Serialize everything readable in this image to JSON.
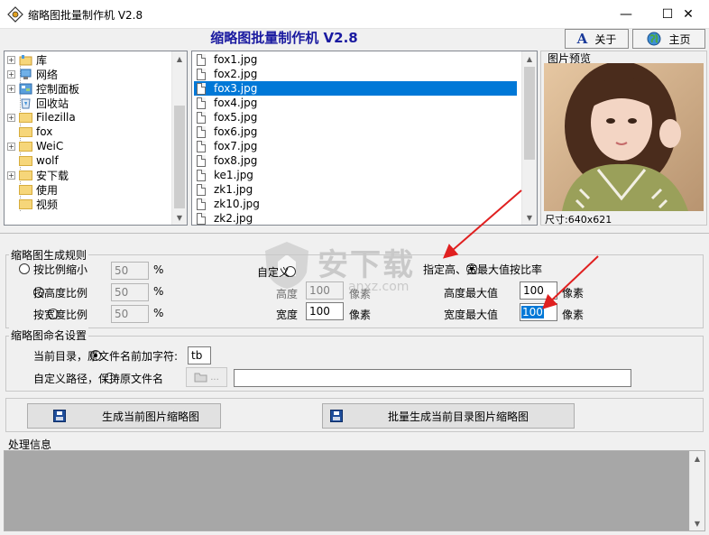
{
  "window": {
    "title": "缩略图批量制作机 V2.8",
    "minimize_glyph": "—",
    "maximize_glyph": "☐",
    "close_glyph": "✕"
  },
  "header": {
    "heading": "缩略图批量制作机  V2.8",
    "about_label": "关于",
    "home_label": "主页"
  },
  "tree": {
    "items": [
      {
        "label": "库",
        "expander": "+",
        "icon": "library-icon"
      },
      {
        "label": "网络",
        "expander": "+",
        "icon": "network-icon"
      },
      {
        "label": "控制面板",
        "expander": "+",
        "icon": "control-panel-icon"
      },
      {
        "label": "回收站",
        "expander": "",
        "icon": "recycle-bin-icon"
      },
      {
        "label": "Filezilla",
        "expander": "+",
        "icon": "folder-icon"
      },
      {
        "label": "fox",
        "expander": "",
        "icon": "folder-icon"
      },
      {
        "label": "WeiC",
        "expander": "+",
        "icon": "folder-icon"
      },
      {
        "label": "wolf",
        "expander": "",
        "icon": "folder-icon"
      },
      {
        "label": "安下载",
        "expander": "+",
        "icon": "folder-icon"
      },
      {
        "label": "使用",
        "expander": "",
        "icon": "folder-icon"
      },
      {
        "label": "视频",
        "expander": "",
        "icon": "folder-icon"
      }
    ]
  },
  "files": {
    "items": [
      "fox1.jpg",
      "fox2.jpg",
      "fox3.jpg",
      "fox4.jpg",
      "fox5.jpg",
      "fox6.jpg",
      "fox7.jpg",
      "fox8.jpg",
      "ke1.jpg",
      "zk1.jpg",
      "zk10.jpg",
      "zk2.jpg"
    ],
    "selected": "fox3.jpg"
  },
  "preview": {
    "title": "图片预览",
    "size_text": "尺寸:640x621"
  },
  "rules": {
    "legend": "缩略图生成规则",
    "scale_label": "按比例缩小",
    "scale_value": "50",
    "scale_unit": "%",
    "by_height_label": "按高度比例",
    "by_height_value": "50",
    "by_height_unit": "%",
    "by_width_label": "按宽度比例",
    "by_width_value": "50",
    "by_width_unit": "%",
    "custom_label": "自定义",
    "custom_height_label": "高度",
    "custom_height_value": "100",
    "custom_height_unit": "像素",
    "custom_width_label": "宽度",
    "custom_width_value": "100",
    "custom_width_unit": "像素",
    "max_label": "指定高、宽最大值按比率",
    "max_height_label": "高度最大值",
    "max_height_value": "100",
    "max_height_unit": "像素",
    "max_width_label": "宽度最大值",
    "max_width_value": "100",
    "max_width_unit": "像素",
    "selected": "max"
  },
  "naming": {
    "legend": "缩略图命名设置",
    "current_dir_label": "当前目录，原文件名前加字符:",
    "prefix_value": "tb",
    "custom_path_label": "自定义路径，保持原文件名",
    "browse_label": "...",
    "path_value": "",
    "selected": "current_dir"
  },
  "actions": {
    "generate_current_label": "生成当前图片缩略图",
    "batch_generate_label": "批量生成当前目录图片缩略图"
  },
  "log": {
    "title": "处理信息"
  },
  "watermark": {
    "text": "安下载",
    "subtext": "anxz.com"
  },
  "colors": {
    "accent": "#0078d7",
    "heading": "#1a1aa0",
    "annotation_arrow": "#e02020",
    "log_bg": "#a7a7a7"
  }
}
